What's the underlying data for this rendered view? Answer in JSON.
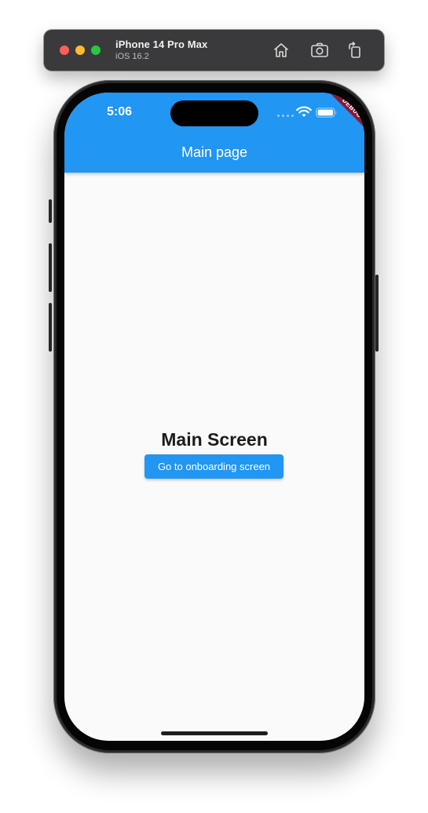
{
  "simulator": {
    "device_name": "iPhone 14 Pro Max",
    "os_version": "iOS 16.2",
    "icons": [
      "home-icon",
      "screenshot-icon",
      "rotate-icon"
    ]
  },
  "status_bar": {
    "time": "5:06",
    "icons": [
      "wifi-icon",
      "battery-icon"
    ]
  },
  "app_bar": {
    "title": "Main page",
    "color": "#2196f3"
  },
  "debug_banner": {
    "label": "DEBUG",
    "color": "#8a1a36"
  },
  "main": {
    "heading": "Main Screen",
    "button_label": "Go to onboarding screen"
  }
}
